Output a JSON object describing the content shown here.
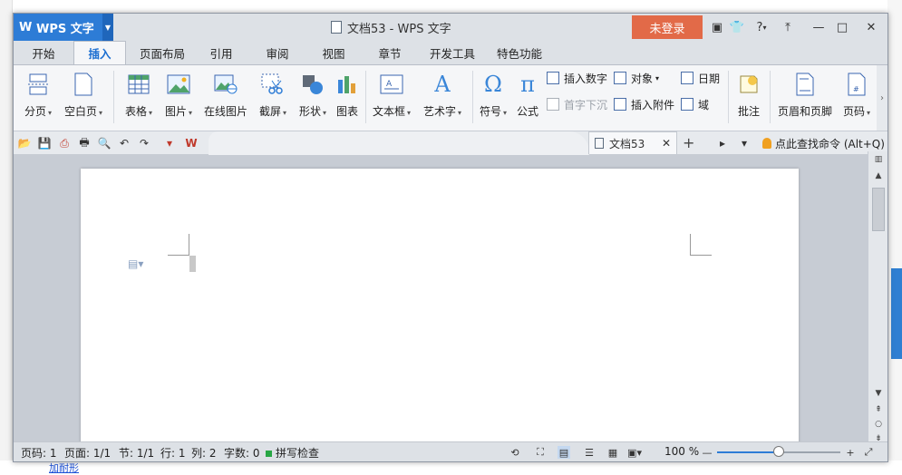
{
  "window": {
    "app_button": "WPS 文字",
    "title": "文档53 - WPS 文字",
    "login_button": "未登录",
    "help_label": "?"
  },
  "tabs": [
    "开始",
    "插入",
    "页面布局",
    "引用",
    "审阅",
    "视图",
    "章节",
    "开发工具",
    "特色功能"
  ],
  "active_tab": "插入",
  "ribbon": {
    "break": "分页",
    "blank_page": "空白页",
    "table": "表格",
    "picture": "图片",
    "online_picture": "在线图片",
    "screenshot": "截屏",
    "shapes": "形状",
    "chart": "图表",
    "textbox": "文本框",
    "wordart": "艺术字",
    "symbol": "符号",
    "equation": "公式",
    "insert_number": "插入数字",
    "drop_cap": "首字下沉",
    "object": "对象",
    "insert_attachment": "插入附件",
    "date": "日期",
    "field": "域",
    "comment": "批注",
    "header_footer": "页眉和页脚",
    "page_number": "页码"
  },
  "doc_tab": {
    "name": "文档53",
    "command_search": "点此查找命令 (Alt+Q)"
  },
  "status": {
    "page": "页码: 1",
    "pages": "页面: 1/1",
    "section": "节: 1/1",
    "row": "行: 1",
    "col": "列: 2",
    "words": "字数: 0",
    "spell": "拼写检查",
    "zoom": "100 %",
    "zoom_fraction": 0.5
  },
  "background": {
    "link_text": "加耐形"
  },
  "colors": {
    "accent": "#2d7cd6",
    "login": "#e26a48"
  }
}
